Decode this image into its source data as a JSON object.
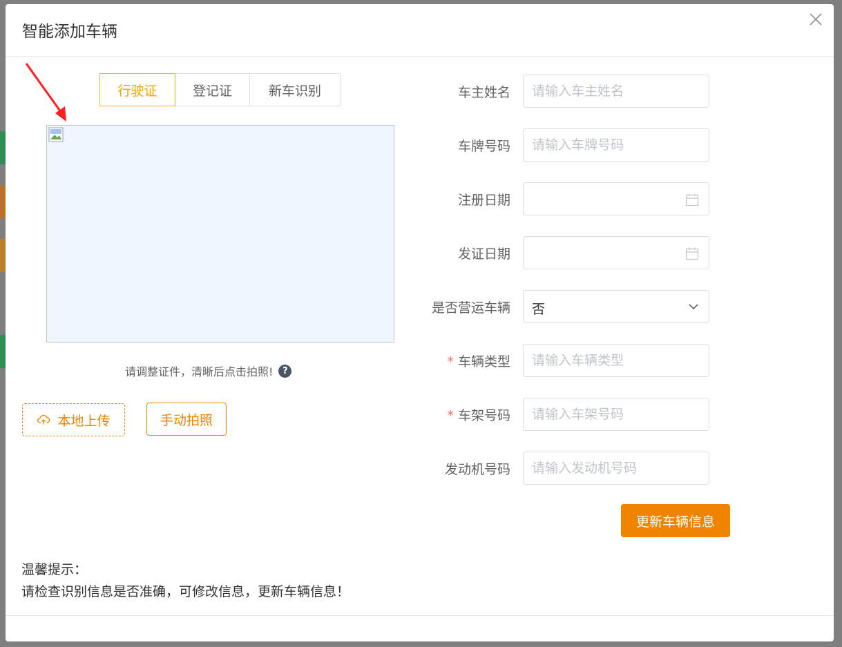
{
  "dialog": {
    "title": "智能添加车辆"
  },
  "tabs": [
    {
      "label": "行驶证",
      "active": true
    },
    {
      "label": "登记证",
      "active": false
    },
    {
      "label": "新车识别",
      "active": false
    }
  ],
  "preview": {
    "hint": "请调整证件，清晰后点击拍照!",
    "help_symbol": "?"
  },
  "buttons": {
    "upload_label": "本地上传",
    "photo_label": "手动拍照",
    "submit_label": "更新车辆信息"
  },
  "form": {
    "owner_name": {
      "label": "车主姓名",
      "placeholder": "请输入车主姓名",
      "required": false
    },
    "plate_number": {
      "label": "车牌号码",
      "placeholder": "请输入车牌号码",
      "required": false
    },
    "register_date": {
      "label": "注册日期",
      "value": "",
      "required": false
    },
    "issue_date": {
      "label": "发证日期",
      "value": "",
      "required": false
    },
    "commercial": {
      "label": "是否营运车辆",
      "value": "否",
      "required": false
    },
    "vehicle_type": {
      "label": "车辆类型",
      "placeholder": "请输入车辆类型",
      "required": true
    },
    "vin": {
      "label": "车架号码",
      "placeholder": "请输入车架号码",
      "required": true
    },
    "engine_number": {
      "label": "发动机号码",
      "placeholder": "请输入发动机号码",
      "required": false
    }
  },
  "required_mark": "*",
  "tips": {
    "heading": "温馨提示：",
    "body": "请检查识别信息是否准确，可修改信息，更新车辆信息！"
  },
  "colors": {
    "accent": "#f08300",
    "tab_active": "#f0a500",
    "required": "#f56c6c",
    "arrow": "#ff1f1f"
  }
}
